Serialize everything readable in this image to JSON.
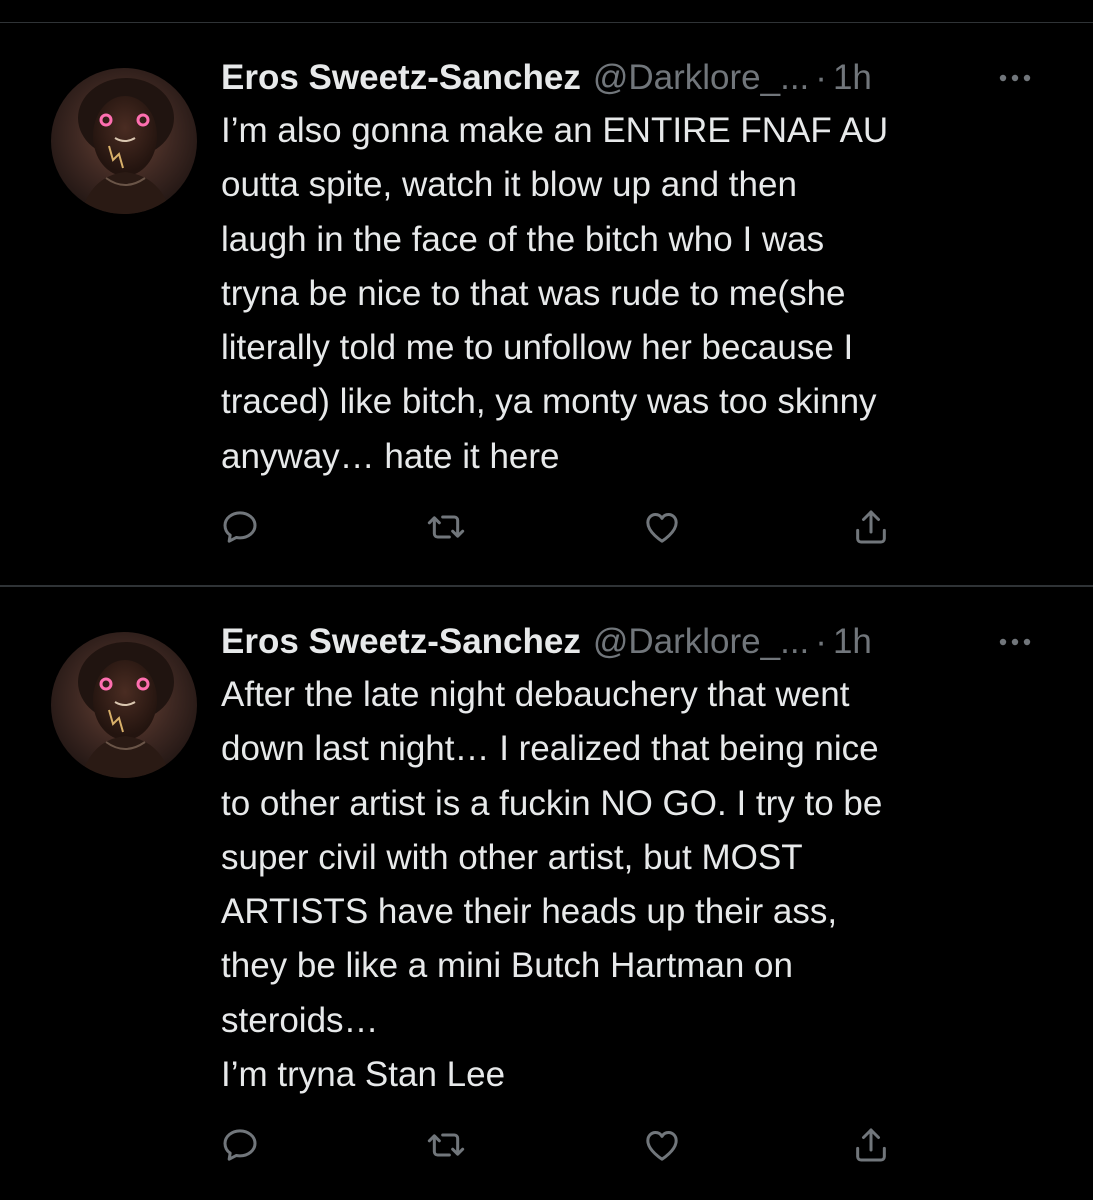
{
  "tweets": [
    {
      "author_name": "Eros Sweetz-Sanchez",
      "handle": "@Darklore_...",
      "separator": "·",
      "time": "1h",
      "more_icon": "more-dots-icon",
      "avatar_icon": "avatar-photo",
      "lines": [
        "I’m also gonna make an ENTIRE FNAF AU",
        "outta spite, watch it blow up and then",
        "laugh in the face of the bitch who I was",
        "tryna be nice to that was rude to me(she",
        "literally told me to unfollow her because I",
        "traced) like bitch, ya monty was too skinny",
        "anyway… hate it here"
      ],
      "actions": [
        "reply-icon",
        "retweet-icon",
        "like-icon",
        "share-icon"
      ]
    },
    {
      "author_name": "Eros Sweetz-Sanchez",
      "handle": "@Darklore_...",
      "separator": "·",
      "time": "1h",
      "more_icon": "more-dots-icon",
      "avatar_icon": "avatar-photo",
      "lines": [
        "After the late night debauchery that went",
        "down last night… I realized that being nice",
        "to other artist is a fuckin NO GO. I try to be",
        "super civil with other artist, but MOST",
        "ARTISTS have their heads up their ass,",
        "they be like a mini Butch Hartman on",
        "steroids…",
        "I’m tryna Stan Lee"
      ],
      "actions": [
        "reply-icon",
        "retweet-icon",
        "like-icon",
        "share-icon"
      ]
    }
  ],
  "colors": {
    "background": "#000000",
    "text_primary": "#e7e9ea",
    "text_secondary": "#71767b",
    "divider": "#2f3336"
  }
}
